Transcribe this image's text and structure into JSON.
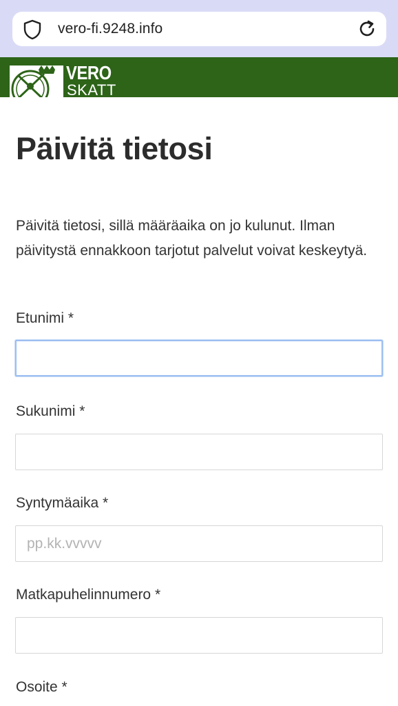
{
  "browser": {
    "url": "vero-fi.9248.info",
    "shield_icon": "shield-icon",
    "reload_icon": "reload-icon"
  },
  "header": {
    "logo_top": "VERO",
    "logo_bottom": "SKATT",
    "brand_color": "#2d6418"
  },
  "main": {
    "title": "Päivitä tietosi",
    "intro": "Päivitä tietosi, sillä määräaika on jo kulunut. Ilman päivitystä ennakkoon tarjotut palvelut voivat kes­keytyä."
  },
  "form": {
    "fields": [
      {
        "label": "Etunimi *",
        "value": "",
        "placeholder": ""
      },
      {
        "label": "Sukunimi *",
        "value": "",
        "placeholder": ""
      },
      {
        "label": "Syntymäaika *",
        "value": "",
        "placeholder": "pp.kk.vvvvv"
      },
      {
        "label": "Matkapuhelinnumero *",
        "value": "",
        "placeholder": ""
      },
      {
        "label": "Osoite *"
      }
    ]
  }
}
